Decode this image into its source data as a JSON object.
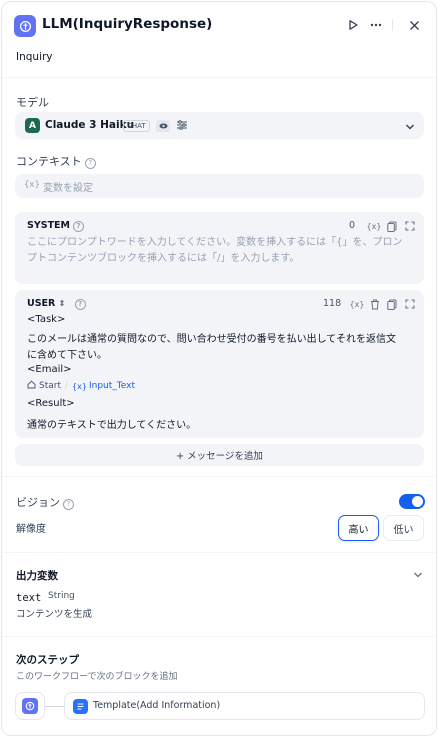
{
  "header": {
    "title": "LLM(InquiryResponse)",
    "description": "Inquiry"
  },
  "model": {
    "label": "モデル",
    "name": "Claude 3 Haiku",
    "mode_badge": "CHAT"
  },
  "context": {
    "label": "コンテキスト",
    "var_icon": "{x}",
    "placeholder": "変数を設定"
  },
  "system_prompt": {
    "role": "SYSTEM",
    "count": "0",
    "placeholder": "ここにプロンプトワードを入力してください。変数を挿入するには「{」を、プロンプトコンテンツブロックを挿入するには「/」を入力します。"
  },
  "user_prompt": {
    "role": "USER",
    "count": "118",
    "lines": [
      "<Task>",
      "このメールは通常の質問なので、問い合わせ受付の番号を払い出してそれを返信文",
      "に含めて下さい。",
      "<Email>",
      "<Result>",
      "通常のテキストで出力してください。"
    ],
    "var_source": "Start",
    "var_separator": "/",
    "var_icon": "{x}",
    "var_name": "Input_Text"
  },
  "add_message": {
    "label": "+ メッセージを追加"
  },
  "vision": {
    "label": "ビジョン",
    "enabled": true,
    "resolution_label": "解像度",
    "options": [
      "高い",
      "低い"
    ],
    "selected": "高い"
  },
  "output": {
    "title": "出力変数",
    "var_name": "text",
    "var_type": "String",
    "var_desc": "コンテンツを生成"
  },
  "next_step": {
    "title": "次のステップ",
    "subtitle": "このワークフローで次のブロックを追加",
    "target": "Template(Add Information)"
  },
  "colors": {
    "accent": "#155eef",
    "node_icon": "#6172f3",
    "model_logo": "#1d6a4f"
  },
  "icons": {
    "node": "llm-brain-icon",
    "run": "play-icon",
    "more": "more-horizontal-icon",
    "close": "close-icon",
    "model_settings": "sliders-icon",
    "model_dropdown": "chevron-down-icon",
    "help": "help-circle-icon",
    "copy": "copy-icon",
    "expand": "expand-icon",
    "delete": "trash-icon",
    "collapse": "chevron-down-icon",
    "home": "home-icon",
    "template": "template-icon"
  }
}
